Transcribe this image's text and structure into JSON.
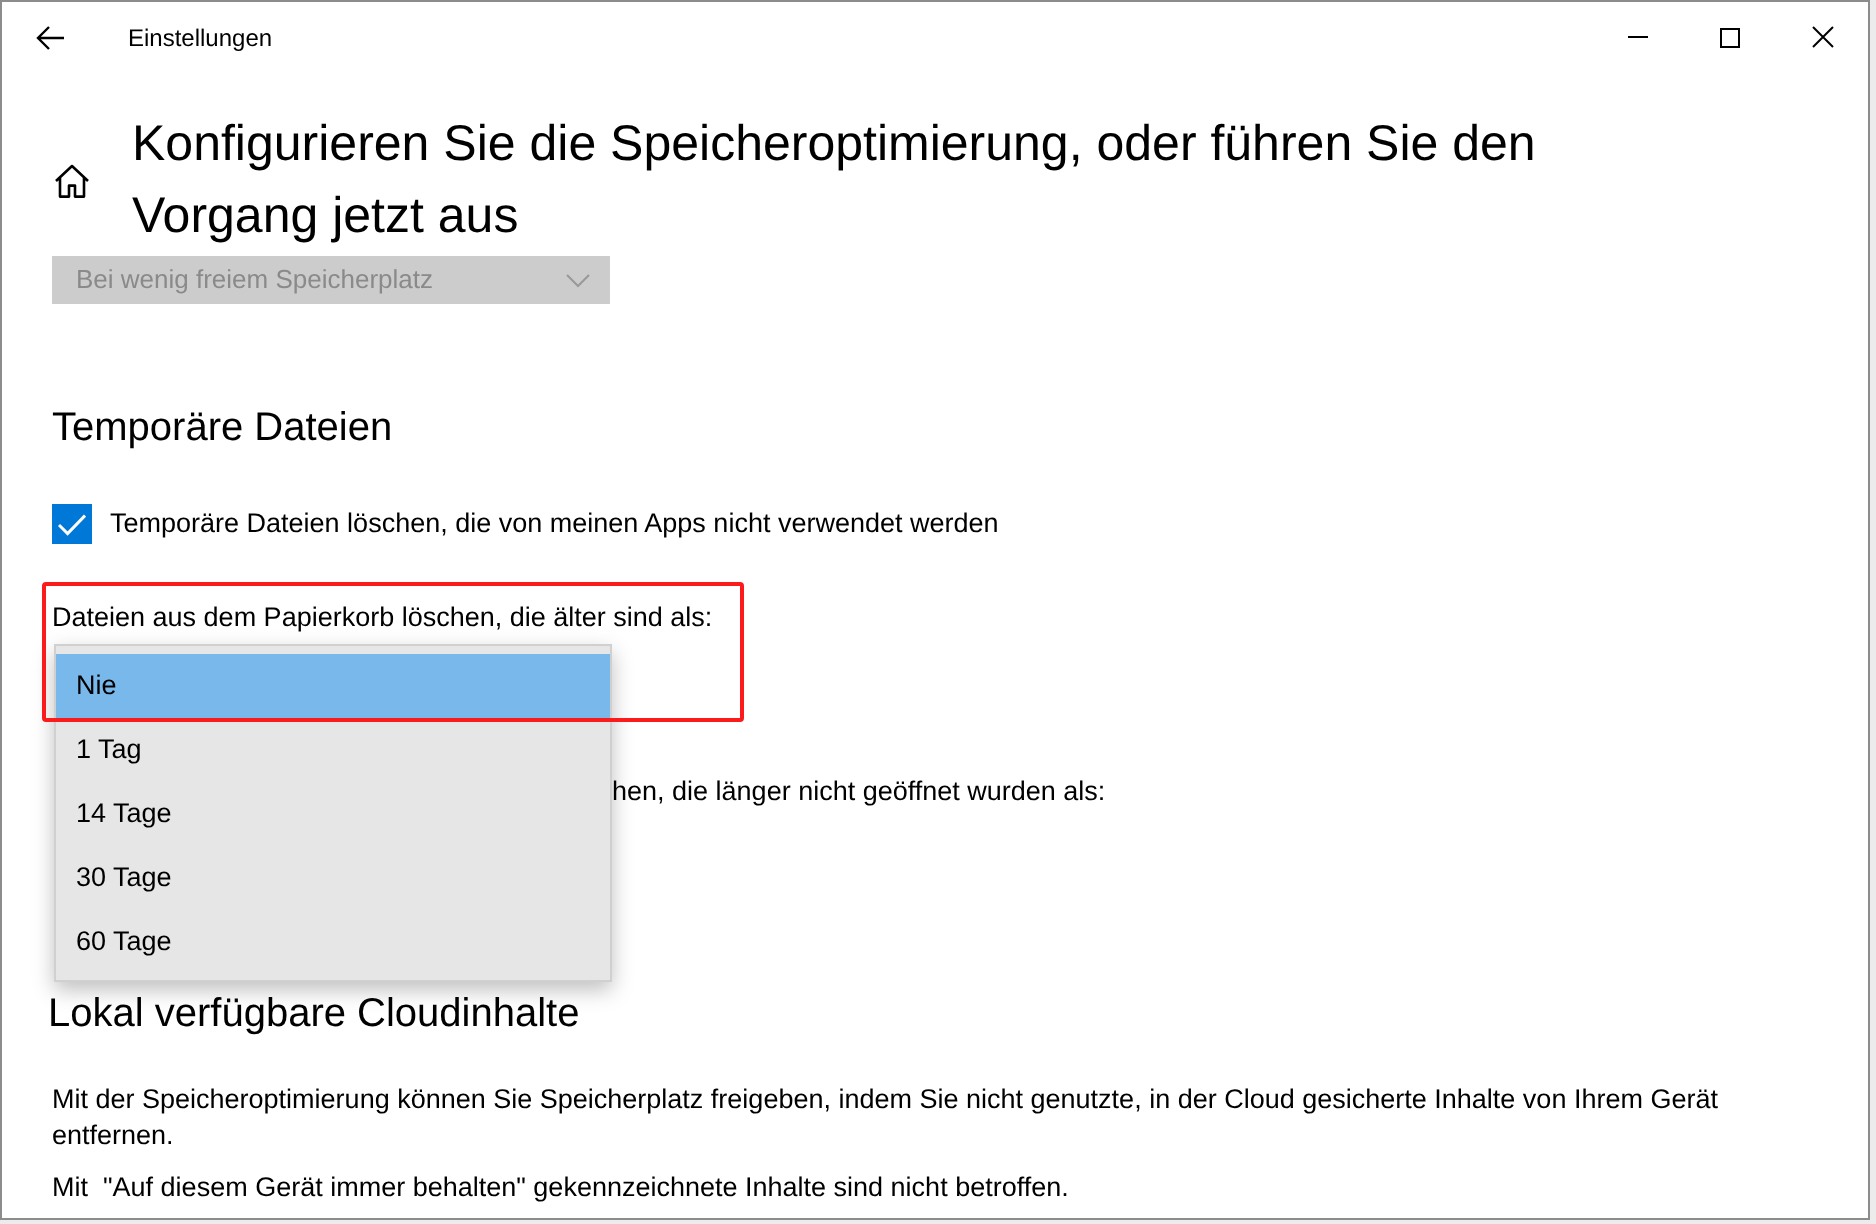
{
  "window": {
    "title": "Einstellungen"
  },
  "page_title": "Konfigurieren Sie die Speicheroptimierung, oder führen Sie den Vorgang jetzt aus",
  "run_dropdown": {
    "value": "Bei wenig freiem Speicherplatz",
    "disabled": true
  },
  "temporary_files": {
    "heading": "Temporäre Dateien",
    "checkbox": {
      "label": "Temporäre Dateien löschen, die von meinen Apps nicht verwendet werden",
      "checked": true
    },
    "recycle_bin": {
      "label": "Dateien aus dem Papierkorb löschen, die älter sind als:",
      "highlighted": true,
      "options": [
        {
          "label": "Nie",
          "selected": true
        },
        {
          "label": "1 Tag",
          "selected": false
        },
        {
          "label": "14 Tage",
          "selected": false
        },
        {
          "label": "30 Tage",
          "selected": false
        },
        {
          "label": "60 Tage",
          "selected": false
        }
      ]
    },
    "setting_2_label": "hen, die länger nicht geöffnet wurden als:"
  },
  "cloud_content": {
    "heading": "Lokal verfügbare Cloudinhalte",
    "paragraphs": [
      "Mit der Speicheroptimierung können Sie Speicherplatz freigeben, indem Sie nicht genutzte, in der Cloud gesicherte Inhalte von Ihrem Gerät entfernen.",
      "Mit  \"Auf diesem Gerät immer behalten\" gekennzeichnete Inhalte sind nicht betroffen."
    ]
  }
}
